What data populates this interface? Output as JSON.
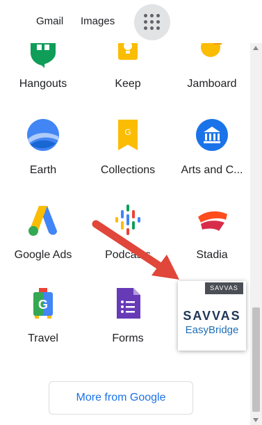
{
  "header": {
    "gmail_label": "Gmail",
    "images_label": "Images",
    "apps_icon": "apps-grid-icon"
  },
  "apps": [
    {
      "label": "Hangouts",
      "icon": "hangouts-icon"
    },
    {
      "label": "Keep",
      "icon": "keep-icon"
    },
    {
      "label": "Jamboard",
      "icon": "jamboard-icon"
    },
    {
      "label": "Earth",
      "icon": "earth-icon"
    },
    {
      "label": "Collections",
      "icon": "collections-icon"
    },
    {
      "label": "Arts and C...",
      "icon": "arts-and-culture-icon"
    },
    {
      "label": "Google Ads",
      "icon": "google-ads-icon"
    },
    {
      "label": "Podcasts",
      "icon": "podcasts-icon"
    },
    {
      "label": "Stadia",
      "icon": "stadia-icon"
    },
    {
      "label": "Travel",
      "icon": "travel-icon"
    },
    {
      "label": "Forms",
      "icon": "forms-icon"
    }
  ],
  "savvas": {
    "tag": "SAVVAS",
    "name": "SAVVAS",
    "sub": "EasyBridge"
  },
  "more_button": "More from Google",
  "colors": {
    "arrow": "#e0463a",
    "link_blue": "#1a73e8",
    "savvas_navy": "#1d3557",
    "savvas_blue": "#1e6fb7"
  }
}
